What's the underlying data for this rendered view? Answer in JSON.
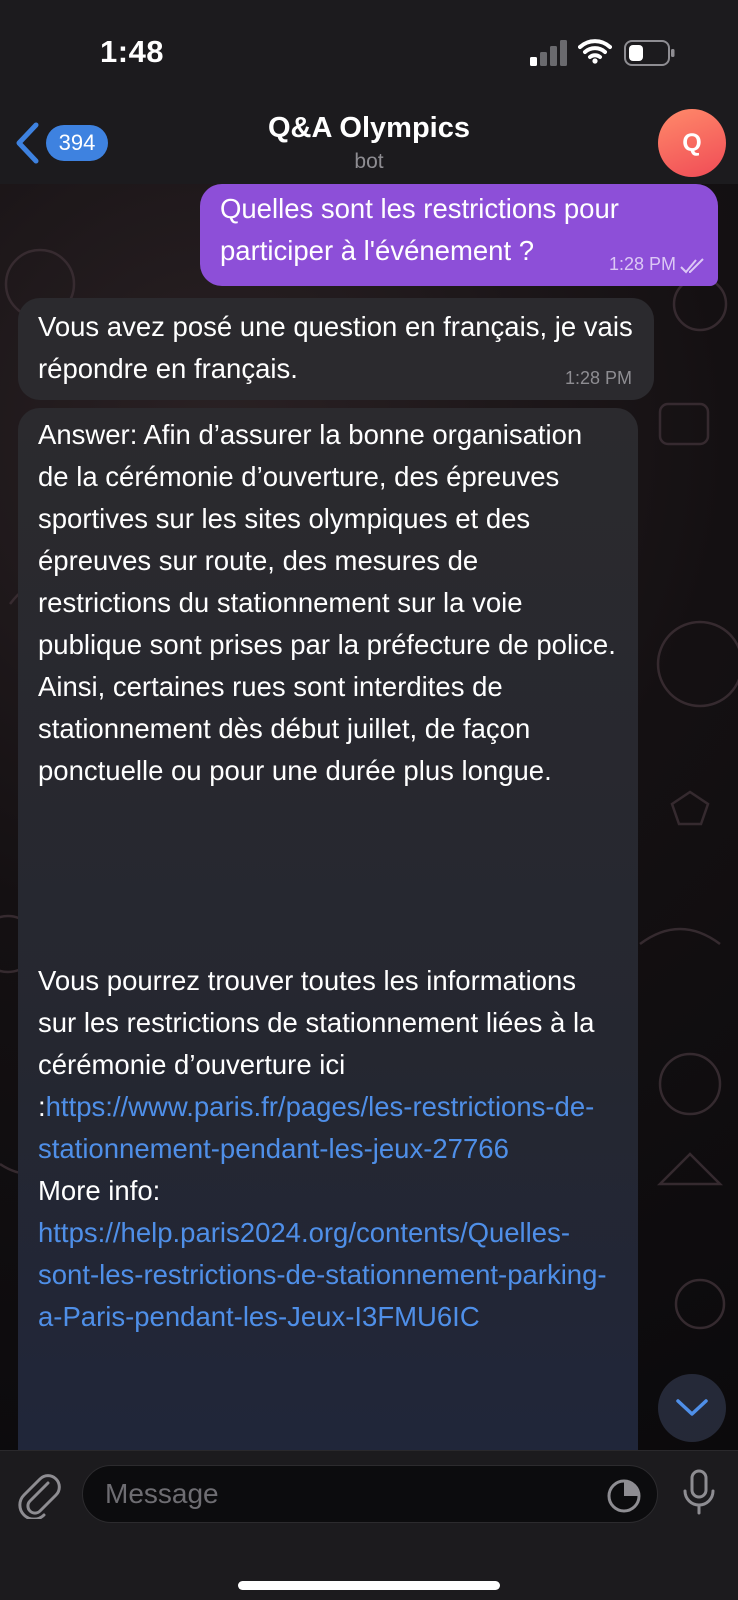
{
  "status_bar": {
    "time": "1:48"
  },
  "header": {
    "back_count": "394",
    "title": "Q&A Olympics",
    "subtitle": "bot",
    "avatar_letter": "Q"
  },
  "messages": {
    "outgoing": {
      "text": "Quelles sont les restrictions pour participer à l'événement ?",
      "time": "1:28 PM"
    },
    "incoming1": {
      "text": "Vous avez posé une question en français, je vais répondre en français.",
      "time": "1:28 PM"
    },
    "incoming2": {
      "answer": "Answer: Afin d’assurer la bonne organisation de la cérémonie d’ouverture, des épreuves sportives sur les sites olympiques et des épreuves sur route, des mesures de restrictions du stationnement sur la voie publique sont prises par la préfecture de police. Ainsi, certaines rues sont interdites de stationnement dès début juillet, de façon ponctuelle ou pour une durée plus longue.",
      "info_text": "Vous pourrez trouver toutes les informations sur les restrictions de stationnement liées à la cérémonie d’ouverture ici :",
      "link1": "https://www.paris.fr/pages/les-restrictions-de-stationnement-pendant-les-jeux-27766",
      "more_label": "More info: ",
      "link2": "https://help.paris2024.org/contents/Quelles-sont-les-restrictions-de-stationnement-parking-a-Paris-pendant-les-Jeux-I3FMU6IC"
    }
  },
  "input": {
    "placeholder": "Message"
  },
  "colors": {
    "accent": "#3e82e0",
    "outgoing_bubble": "#8d4fd8",
    "incoming_bubble": "#2b2a2e",
    "link": "#4f8fe8",
    "avatar_gradient": [
      "#ff8a6a",
      "#f04b56"
    ]
  },
  "icons": {
    "back": "chevron-left-icon",
    "signal": "cellular-signal-icon",
    "wifi": "wifi-icon",
    "battery": "battery-icon",
    "read": "double-check-icon",
    "attach": "paperclip-icon",
    "sticker": "sticker-icon",
    "mic": "microphone-icon",
    "scroll": "chevron-down-icon"
  }
}
